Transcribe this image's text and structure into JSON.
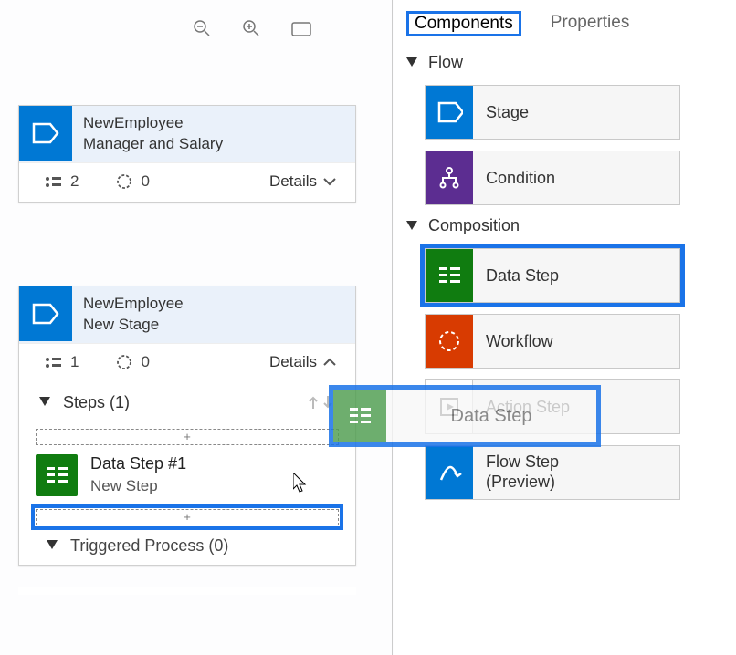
{
  "toolbar": {
    "zoom_out": "zoom-out",
    "zoom_in": "zoom-in",
    "fit": "fit-screen"
  },
  "cards": [
    {
      "entity": "NewEmployee",
      "stage": "Manager and Salary",
      "steps_count": "2",
      "wf_count": "0",
      "details_label": "Details",
      "expanded": false
    },
    {
      "entity": "NewEmployee",
      "stage": "New Stage",
      "steps_count": "1",
      "wf_count": "0",
      "details_label": "Details",
      "expanded": true,
      "steps_header": "Steps (1)",
      "step": {
        "title": "Data Step #1",
        "subtitle": "New Step"
      },
      "triggered": "Triggered Process (0)",
      "dropzone_plus": "+"
    }
  ],
  "panel": {
    "tabs": {
      "components": "Components",
      "properties": "Properties"
    },
    "sections": {
      "flow": {
        "title": "Flow",
        "items": [
          {
            "label": "Stage",
            "icon": "stage",
            "color": "ic-blue"
          },
          {
            "label": "Condition",
            "icon": "condition",
            "color": "ic-purple"
          }
        ]
      },
      "composition": {
        "title": "Composition",
        "items": [
          {
            "label": "Data Step",
            "icon": "datastep",
            "color": "ic-green",
            "highlight": true
          },
          {
            "label": "Workflow",
            "icon": "workflow",
            "color": "ic-orange"
          },
          {
            "label": "Action Step",
            "icon": "action",
            "color": "ic-white"
          },
          {
            "label": "Flow Step",
            "label2": "(Preview)",
            "icon": "flowstep",
            "color": "ic-blue2"
          }
        ]
      }
    }
  },
  "ghost": {
    "label": "Data Step"
  }
}
